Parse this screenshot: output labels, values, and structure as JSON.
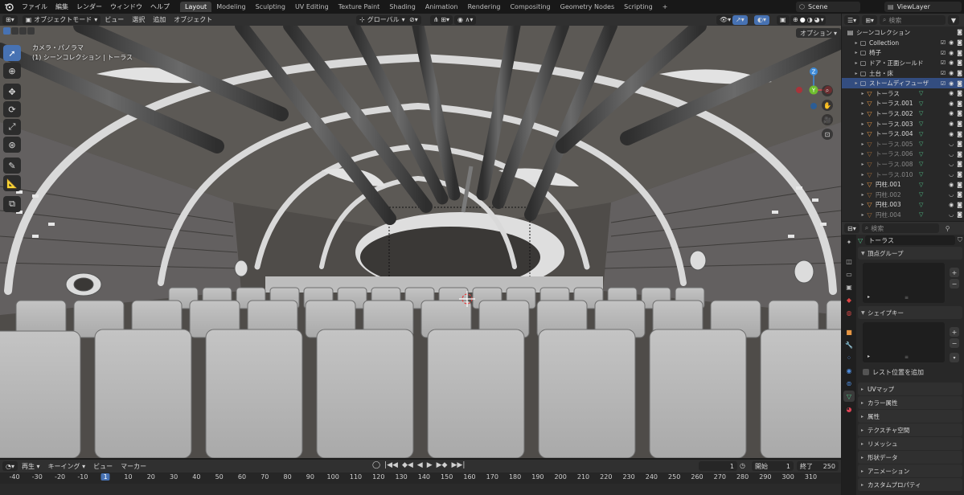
{
  "topbar": {
    "menus": [
      "ファイル",
      "編集",
      "レンダー",
      "ウィンドウ",
      "ヘルプ"
    ],
    "workspaces": [
      "Layout",
      "Modeling",
      "Sculpting",
      "UV Editing",
      "Texture Paint",
      "Shading",
      "Animation",
      "Rendering",
      "Compositing",
      "Geometry Nodes",
      "Scripting"
    ],
    "active_workspace": "Layout",
    "add_tab": "+",
    "scene": "Scene",
    "view_layer": "ViewLayer"
  },
  "viewport_header": {
    "mode": "オブジェクトモード",
    "menus": [
      "ビュー",
      "選択",
      "追加",
      "オブジェクト"
    ],
    "transform_orientation": "グローバル",
    "options": "オプション"
  },
  "viewport": {
    "camera_label": "カメラ・パノラマ",
    "collection_label": "(1) シーンコレクション | トーラス"
  },
  "timeline": {
    "playback": "再生",
    "keying": "キーイング",
    "view": "ビュー",
    "marker": "マーカー",
    "current_frame": "1",
    "start_label": "開始",
    "start": "1",
    "end_label": "終了",
    "end": "250",
    "ticks": [
      "-40",
      "-30",
      "-20",
      "-10",
      "1",
      "10",
      "20",
      "30",
      "40",
      "50",
      "60",
      "70",
      "80",
      "90",
      "100",
      "110",
      "120",
      "130",
      "140",
      "150",
      "160",
      "170",
      "180",
      "190",
      "200",
      "210",
      "220",
      "230",
      "240",
      "250",
      "260",
      "270",
      "280",
      "290",
      "300",
      "310"
    ]
  },
  "outliner": {
    "search_placeholder": "検索",
    "root": "シーンコレクション",
    "items": [
      {
        "label": "Collection",
        "level": 1,
        "type": "collection",
        "selected": false,
        "dim": false
      },
      {
        "label": "椅子",
        "level": 1,
        "type": "collection",
        "selected": false,
        "dim": false
      },
      {
        "label": "ドア・正面シールド",
        "level": 1,
        "type": "collection",
        "selected": false,
        "dim": false
      },
      {
        "label": "土台・床",
        "level": 1,
        "type": "collection",
        "selected": false,
        "dim": false
      },
      {
        "label": "ストームディフューザ",
        "level": 1,
        "type": "collection",
        "selected": true,
        "dim": false
      },
      {
        "label": "トーラス",
        "level": 2,
        "type": "mesh",
        "selected": false,
        "dim": false
      },
      {
        "label": "トーラス.001",
        "level": 2,
        "type": "mesh",
        "selected": false,
        "dim": false
      },
      {
        "label": "トーラス.002",
        "level": 2,
        "type": "mesh",
        "selected": false,
        "dim": false
      },
      {
        "label": "トーラス.003",
        "level": 2,
        "type": "mesh",
        "selected": false,
        "dim": false
      },
      {
        "label": "トーラス.004",
        "level": 2,
        "type": "mesh",
        "selected": false,
        "dim": false
      },
      {
        "label": "トーラス.005",
        "level": 2,
        "type": "mesh",
        "selected": false,
        "dim": true
      },
      {
        "label": "トーラス.006",
        "level": 2,
        "type": "mesh",
        "selected": false,
        "dim": true
      },
      {
        "label": "トーラス.008",
        "level": 2,
        "type": "mesh",
        "selected": false,
        "dim": true
      },
      {
        "label": "トーラス.010",
        "level": 2,
        "type": "mesh",
        "selected": false,
        "dim": true
      },
      {
        "label": "円柱.001",
        "level": 2,
        "type": "mesh",
        "selected": false,
        "dim": false
      },
      {
        "label": "円柱.002",
        "level": 2,
        "type": "mesh",
        "selected": false,
        "dim": true
      },
      {
        "label": "円柱.003",
        "level": 2,
        "type": "mesh",
        "selected": false,
        "dim": false
      },
      {
        "label": "円柱.004",
        "level": 2,
        "type": "mesh",
        "selected": false,
        "dim": true
      }
    ]
  },
  "properties": {
    "search_placeholder": "検索",
    "object_name": "トーラス",
    "vertex_groups": "頂点グループ",
    "shape_keys": "シェイプキー",
    "rest_position": "レスト位置を追加",
    "panels": [
      "UVマップ",
      "カラー属性",
      "属性",
      "テクスチャ空間",
      "リメッシュ",
      "形状データ",
      "アニメーション",
      "カスタムプロパティ"
    ]
  },
  "colors": {
    "accent": "#4772b3",
    "selected_row": "#334d80",
    "object_orange": "#e69644",
    "mesh_green": "#52c48a",
    "axis_x": "#e0474c",
    "axis_y": "#6fbe2f",
    "axis_z": "#3d8bd9"
  }
}
